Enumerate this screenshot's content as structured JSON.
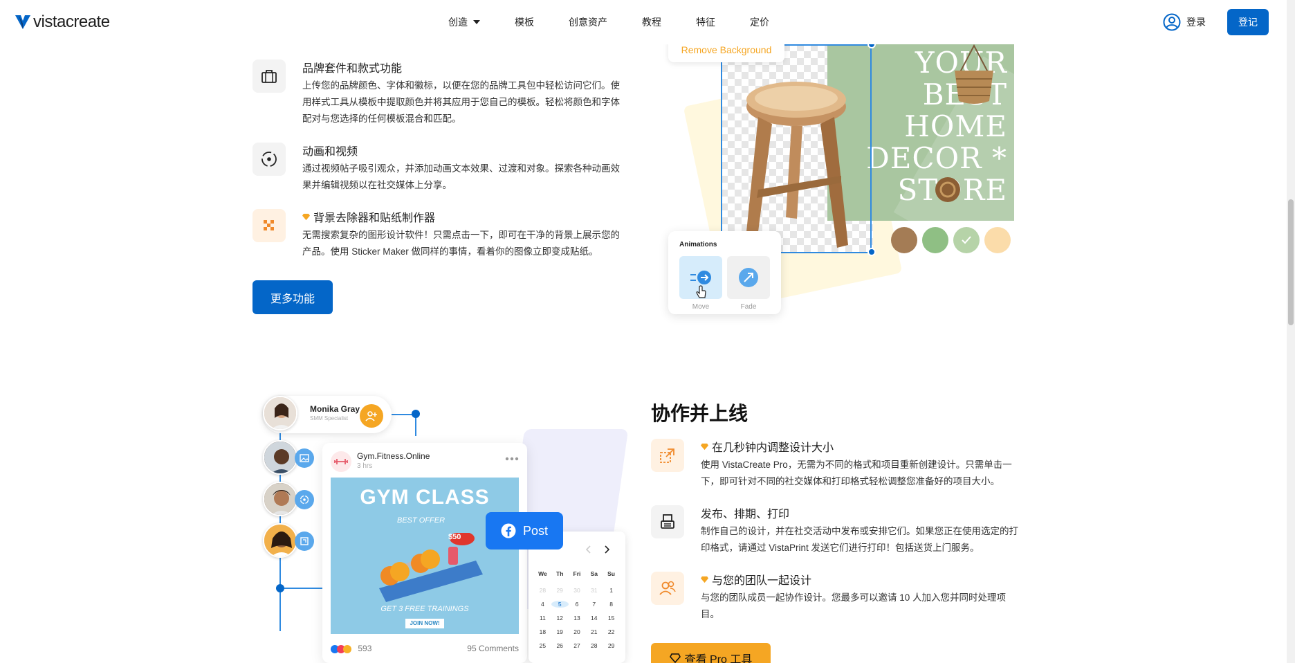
{
  "nav": {
    "logo": "vistacreate",
    "menu": [
      {
        "label": "创造",
        "has_caret": true
      },
      {
        "label": "模板"
      },
      {
        "label": "创意资产"
      },
      {
        "label": "教程"
      },
      {
        "label": "特征"
      },
      {
        "label": "定价"
      }
    ],
    "login_label": "登录",
    "signup_label": "登记"
  },
  "features_top": [
    {
      "icon": "briefcase-icon",
      "title": "品牌套件和款式功能",
      "premium": false,
      "desc": [
        "上传您的品牌颜色、字体和徽标，以便在您的品牌工具包中轻松访问它们。使",
        "用样式工具从模板中提取颜色并将其应用于您自己的模板。轻松将颜色和字体",
        "配对与您选择的任何模板混合和匹配。"
      ]
    },
    {
      "icon": "animation-icon",
      "title": "动画和视频",
      "premium": false,
      "desc": [
        "通过视频帖子吸引观众，并添加动画文本效果、过渡和对象。探索各种动画效",
        "果并编辑视频以在社交媒体上分享。"
      ]
    },
    {
      "icon": "checker-icon",
      "title": "背景去除器和贴纸制作器",
      "premium": true,
      "desc": [
        "无需搜索复杂的图形设计软件！只需点击一下，即可在干净的背景上展示您的",
        "产品。使用 Sticker Maker 做同样的事情，看着你的图像立即变成贴纸。"
      ]
    }
  ],
  "more_features_label": "更多功能",
  "illustration_a": {
    "tag": "Remove Background",
    "decor_text": [
      "YOUR",
      "BEST",
      "HOME",
      "DECOR *",
      "STORE"
    ],
    "swatches": [
      "#a47c55",
      "#8fbf84",
      "#b6d3a8",
      "#fbdcaa"
    ],
    "animations_title": "Animations",
    "anim_move": "Move",
    "anim_fade": "Fade"
  },
  "collab_heading": "协作并上线",
  "features_bottom": [
    {
      "icon": "resize-icon",
      "title": "在几秒钟内调整设计大小",
      "premium": true,
      "desc": [
        "使用 VistaCreate Pro，无需为不同的格式和项目重新创建设计。只需单击一",
        "下，即可针对不同的社交媒体和打印格式轻松调整您准备好的项目大小。"
      ]
    },
    {
      "icon": "printer-icon",
      "title": "发布、排期、打印",
      "premium": false,
      "desc": [
        "制作自己的设计，并在社交活动中发布或安排它们。如果您正在使用选定的打",
        "印格式，请通过 VistaPrint 发送它们进行打印！包括送货上门服务。"
      ]
    },
    {
      "icon": "team-icon",
      "title": "与您的团队一起设计",
      "premium": true,
      "desc": [
        "与您的团队成员一起协作设计。您最多可以邀请 10 人加入您并同时处理项",
        "目。"
      ]
    }
  ],
  "pro_button_label": "查看 Pro 工具",
  "illustration_b": {
    "person_name": "Monika Gray",
    "person_role": "SMM Specialist",
    "account": "Gym.Fitness.Online",
    "time": "3 hrs",
    "gym_title": "GYM CLASS",
    "gym_sub": "BEST OFFER",
    "gym_bottom": "GET 3 FREE TRAININGS",
    "gym_join": "JOIN NOW!",
    "price": "$50",
    "likes": "593",
    "comments": "95 Comments",
    "post_button": "Post",
    "calendar_days": [
      "We",
      "Th",
      "Fri",
      "Sa",
      "Su"
    ],
    "calendar_rows": [
      [
        "28",
        "29",
        "30",
        "31",
        "1"
      ],
      [
        "4",
        "5",
        "6",
        "7",
        "8"
      ],
      [
        "11",
        "12",
        "13",
        "14",
        "15"
      ],
      [
        "18",
        "19",
        "20",
        "21",
        "22"
      ],
      [
        "25",
        "26",
        "27",
        "28",
        "29"
      ]
    ]
  },
  "colors": {
    "brand_blue": "#0466c8",
    "accent_orange": "#f5a623",
    "facebook": "#1877f2"
  }
}
